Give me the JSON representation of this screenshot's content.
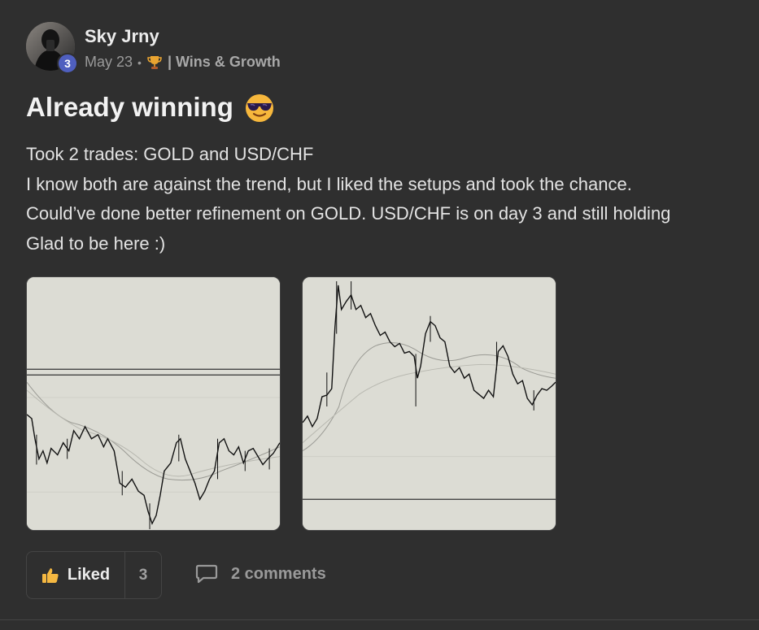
{
  "post": {
    "author": "Sky Jrny",
    "level": "3",
    "date": "May 23",
    "separator": "•",
    "category": "| Wins & Growth",
    "title": "Already winning",
    "body_lines": [
      "Took 2 trades: GOLD and USD/CHF",
      "I know both are against the trend, but I liked the setups and took the chance.",
      "Could’ve done better refinement on GOLD. USD/CHF is on day 3 and still holding",
      "Glad to be here :)"
    ]
  },
  "actions": {
    "like_label": "Liked",
    "like_count": "3",
    "comments_label": "2 comments"
  },
  "icons": {
    "trophy": "trophy-icon",
    "title_emoji": "smiling-face-with-sunglasses-icon",
    "like": "thumbs-up-icon",
    "comments": "comment-bubble-icon"
  },
  "colors": {
    "background": "#2f2f2f",
    "level_badge": "#4f5fbf",
    "chart_background": "#dcdcd4",
    "thumb": "#f5b841"
  }
}
